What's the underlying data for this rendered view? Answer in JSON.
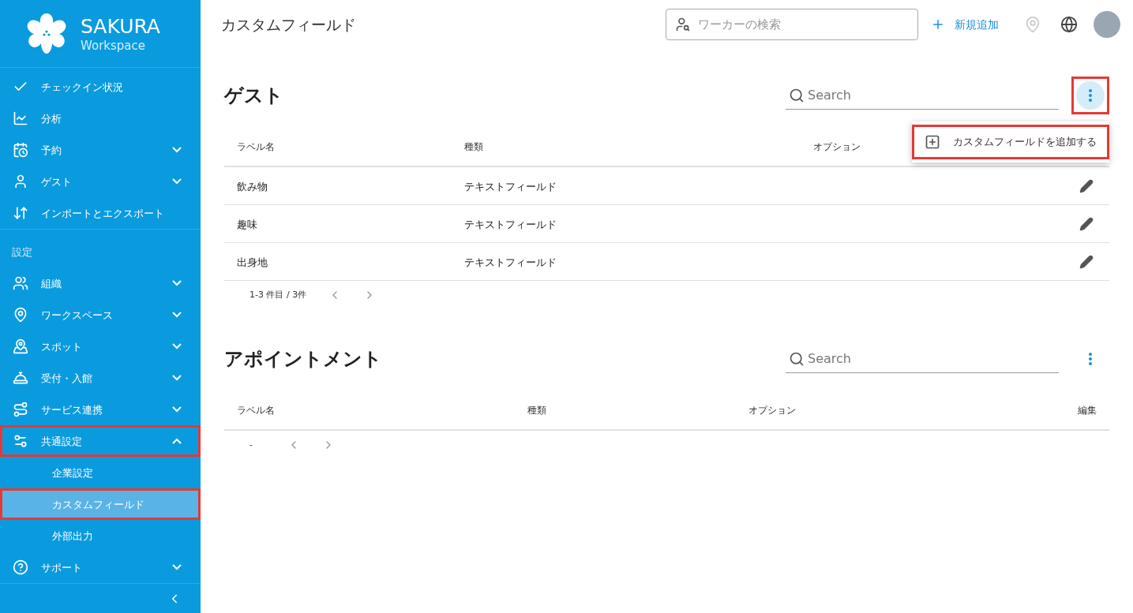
{
  "brand": {
    "name": "SAKURA",
    "subtitle": "Workspace"
  },
  "sidebar": {
    "items": [
      {
        "kind": "link",
        "label": "チェックイン状況",
        "highlighted": false
      },
      {
        "kind": "link",
        "label": "分析",
        "highlighted": false
      },
      {
        "kind": "menu",
        "label": "予約",
        "expanded": false,
        "highlighted": false
      },
      {
        "kind": "menu",
        "label": "ゲスト",
        "expanded": false,
        "highlighted": false
      },
      {
        "kind": "link",
        "label": "インポートとエクスポート",
        "highlighted": false
      },
      {
        "kind": "section",
        "label": "設定"
      },
      {
        "kind": "menu",
        "label": "組織",
        "expanded": false,
        "highlighted": false
      },
      {
        "kind": "menu",
        "label": "ワークスペース",
        "expanded": false,
        "highlighted": false
      },
      {
        "kind": "menu",
        "label": "スポット",
        "expanded": false,
        "highlighted": false
      },
      {
        "kind": "menu",
        "label": "受付・入館",
        "expanded": false,
        "highlighted": false
      },
      {
        "kind": "menu",
        "label": "サービス連携",
        "expanded": false,
        "highlighted": false
      },
      {
        "kind": "menu",
        "label": "共通設定",
        "expanded": true,
        "highlighted": true,
        "children": [
          {
            "label": "企業設定",
            "selected": false,
            "highlighted": false
          },
          {
            "label": "カスタムフィールド",
            "selected": true,
            "highlighted": true
          },
          {
            "label": "外部出力",
            "selected": false,
            "highlighted": false
          }
        ]
      },
      {
        "kind": "menu",
        "label": "サポート",
        "expanded": false,
        "highlighted": false
      }
    ]
  },
  "header": {
    "title": "カスタムフィールド",
    "search": {
      "placeholder": "ワーカーの検索"
    },
    "add_button": "新規追加"
  },
  "sections": [
    {
      "title": "ゲスト",
      "search": {
        "placeholder": "Search"
      },
      "menu_button": {
        "highlighted": true
      },
      "menu": [
        {
          "label": "カスタムフィールドを追加する",
          "highlighted": true
        }
      ],
      "columns": [
        "ラベル名",
        "種類",
        "オプション"
      ],
      "rows": [
        {
          "cells": [
            "飲み物",
            "テキストフィールド"
          ]
        },
        {
          "cells": [
            "趣味",
            "テキストフィールド"
          ]
        },
        {
          "cells": [
            "出身地",
            "テキストフィールド"
          ]
        }
      ],
      "pagination": "1-3 件目 / 3件"
    },
    {
      "title": "アポイントメント",
      "search": {
        "placeholder": "Search"
      },
      "menu_button": {
        "highlighted": false
      },
      "columns": [
        "ラベル名",
        "種類",
        "オプション",
        "編集"
      ],
      "pagination": "-"
    }
  ]
}
